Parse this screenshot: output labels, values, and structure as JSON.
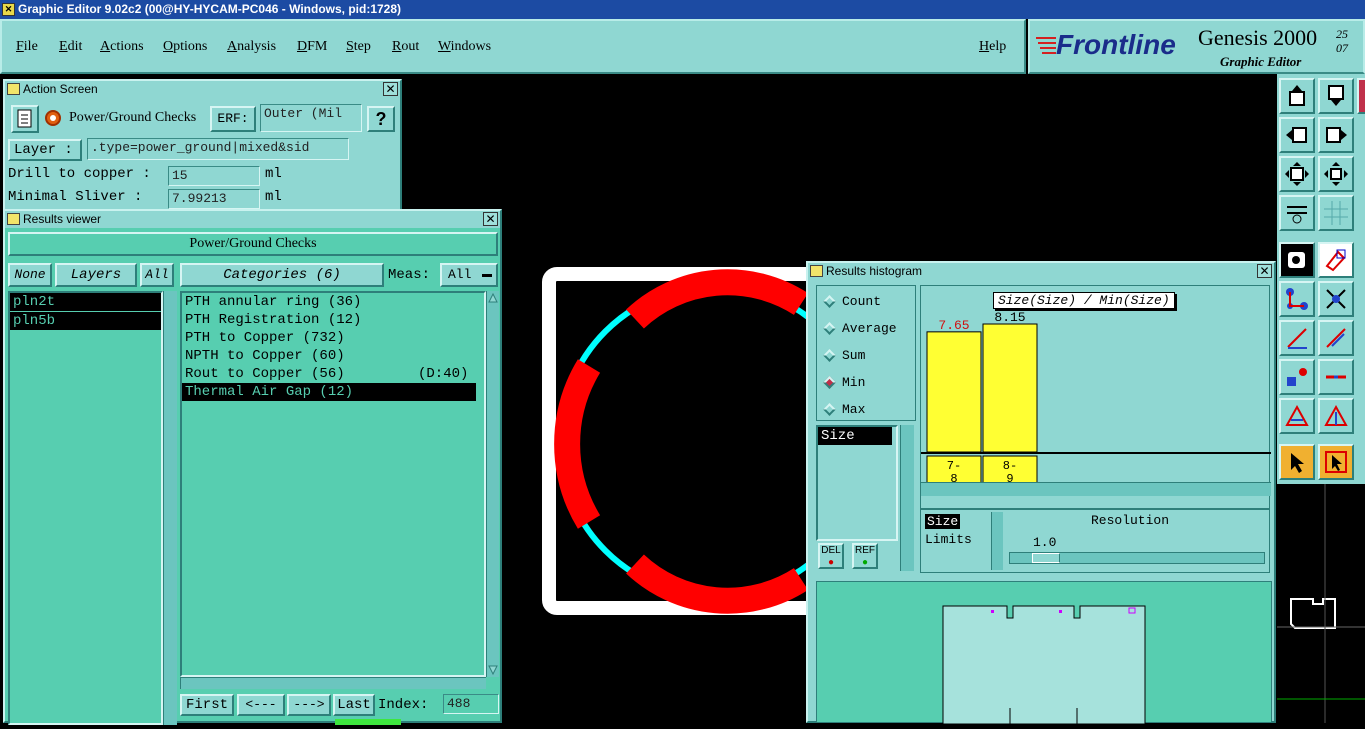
{
  "window": {
    "title": "Graphic Editor 9.02c2 (00@HY-HYCAM-PC046 - Windows, pid:1728)"
  },
  "menu": [
    "File",
    "Edit",
    "Actions",
    "Options",
    "Analysis",
    "DFM",
    "Step",
    "Rout",
    "Windows"
  ],
  "help_label": "Help",
  "brand": {
    "logo": "Frontline",
    "product": "Genesis 2000",
    "subtitle": "Graphic Editor",
    "date_line1": "25",
    "date_line2": "07"
  },
  "action_screen": {
    "title": "Action Screen",
    "action_name": "Power/Ground Checks",
    "erf_label": "ERF:",
    "erf_value": "Outer (Mil",
    "help_btn": "?",
    "layer_label": "Layer :",
    "layer_value": ".type=power_ground|mixed&sid",
    "drill_label": "Drill to copper :",
    "drill_value": "15",
    "drill_unit": "ml",
    "sliver_label": "Minimal Sliver   :",
    "sliver_value": "7.99213",
    "sliver_unit": "ml"
  },
  "results_viewer": {
    "title": "Results viewer",
    "header": "Power/Ground Checks",
    "none_btn": "None",
    "layers_btn": "Layers",
    "all_btn": "All",
    "categories_btn": "Categories (6)",
    "meas_label": "Meas:",
    "meas_value": "All",
    "layers": [
      {
        "name": "pln2t"
      },
      {
        "name": "pln5b"
      }
    ],
    "categories": [
      {
        "label": "PTH annular ring (36)",
        "extra": ""
      },
      {
        "label": "PTH Registration (12)",
        "extra": ""
      },
      {
        "label": "PTH to Copper (732)",
        "extra": ""
      },
      {
        "label": "NPTH to Copper (60)",
        "extra": ""
      },
      {
        "label": "Rout to Copper (56)",
        "extra": "(D:40)"
      },
      {
        "label": "Thermal Air Gap (12)",
        "extra": ""
      }
    ],
    "first_btn": "First",
    "prev_btn": "<---",
    "next_btn": "--->",
    "last_btn": "Last",
    "index_label": "Index:",
    "index_value": "488"
  },
  "histogram": {
    "title": "Results histogram",
    "modes": [
      "Count",
      "Average",
      "Sum",
      "Min",
      "Max"
    ],
    "selected_mode": "Min",
    "list_items": [
      "Size"
    ],
    "chart_title": "Size(Size) / Min(Size)",
    "size_label": "Size",
    "limits_label": "Limits",
    "resolution_label": "Resolution",
    "resolution_value": "1.0",
    "del_btn": "DEL",
    "ref_btn": "REF"
  },
  "chart_data": {
    "type": "bar",
    "title": "Size(Size) / Min(Size)",
    "categories": [
      "7-8",
      "8-9"
    ],
    "values": [
      7.65,
      8.15
    ],
    "value_labels": [
      "7.65",
      "8.15"
    ],
    "category_labels": [
      [
        "7-",
        "8"
      ],
      [
        "8-",
        "9"
      ]
    ],
    "bar_color": "#ffff33",
    "highlight_color": "#d01010"
  },
  "colors": {
    "panel": "#8fd7d2",
    "list": "#57ceb0",
    "accent_red": "#ff0000",
    "cyan": "#00ffff"
  }
}
